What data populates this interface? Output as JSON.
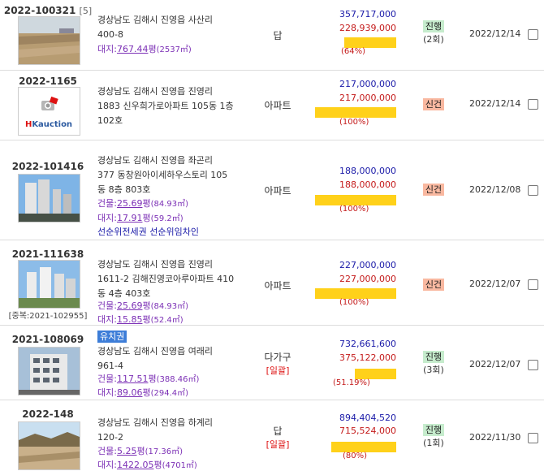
{
  "rows": [
    {
      "case": "2022-100321",
      "case_sub": "[5]",
      "addr": [
        "경상남도 김해시 진영읍 사산리",
        "400-8"
      ],
      "area_label": "대지:",
      "area_value": "767.44",
      "area_unit": "평",
      "area_m2": "(2537㎡)",
      "type": "답",
      "type_note": "",
      "price1": "357,717,000",
      "price2": "228,939,000",
      "percent": "(64%)",
      "ratio": 0.64,
      "status": "진행",
      "status_kind": "ing",
      "status_count": "(2회)",
      "date": "2022/12/14",
      "photo": "land"
    },
    {
      "case": "2022-1165",
      "addr": [
        "경상남도 김해시 진영읍 진영리",
        "1883 신우희가로아파트 105동 1층",
        "102호"
      ],
      "type": "아파트",
      "type_note": "",
      "price1": "217,000,000",
      "price2": "217,000,000",
      "percent": "(100%)",
      "ratio": 1.0,
      "status": "신건",
      "status_kind": "new",
      "status_count": "",
      "date": "2022/12/14",
      "photo": "logo",
      "logo_text": "Kauction",
      "logo_prefix": "H"
    },
    {
      "case": "2022-101416",
      "addr": [
        "경상남도 김해시 진영읍 좌곤리",
        "377 동창원아이세하우스토리 105",
        "동 8층 803호"
      ],
      "bld_label": "건물:",
      "bld_value": "25.69",
      "bld_unit": "평",
      "bld_m2": "(84.93㎡)",
      "land_label": "대지:",
      "land_value": "17.91",
      "land_unit": "평",
      "land_m2": "(59.2㎡)",
      "extra": "선순위전세권 선순위임차인",
      "type": "아파트",
      "type_note": "",
      "price1": "188,000,000",
      "price2": "188,000,000",
      "percent": "(100%)",
      "ratio": 1.0,
      "status": "신건",
      "status_kind": "new",
      "status_count": "",
      "date": "2022/12/08",
      "photo": "apt"
    },
    {
      "case": "2021-111638",
      "dup": "[중복:2021-102955]",
      "addr": [
        "경상남도 김해시 진영읍 진영리",
        "1611-2 김해진영코아루아파트 410",
        "동 4층 403호"
      ],
      "bld_label": "건물:",
      "bld_value": "25.69",
      "bld_unit": "평",
      "bld_m2": "(84.93㎡)",
      "land_label": "대지:",
      "land_value": "15.85",
      "land_unit": "평",
      "land_m2": "(52.4㎡)",
      "type": "아파트",
      "type_note": "",
      "price1": "227,000,000",
      "price2": "227,000,000",
      "percent": "(100%)",
      "ratio": 1.0,
      "status": "신건",
      "status_kind": "new",
      "status_count": "",
      "date": "2022/12/07",
      "photo": "apt2"
    },
    {
      "case": "2021-108069",
      "tag": "유치권",
      "addr": [
        "경상남도 김해시 진영읍 여래리",
        "961-4"
      ],
      "bld_label": "건물:",
      "bld_value": "117.51",
      "bld_unit": "평",
      "bld_m2": "(388.46㎡)",
      "land_label": "대지:",
      "land_value": "89.06",
      "land_unit": "평",
      "land_m2": "(294.4㎡)",
      "type": "다가구",
      "type_note": "[일괄]",
      "price1": "732,661,600",
      "price2": "375,122,000",
      "percent": "(51.19%)",
      "ratio": 0.5119,
      "status": "진행",
      "status_kind": "ing",
      "status_count": "(3회)",
      "date": "2022/12/07",
      "photo": "bldg"
    },
    {
      "case": "2022-148",
      "addr": [
        "경상남도 김해시 진영읍 하계리",
        "120-2"
      ],
      "bld_label": "건물:",
      "bld_value": "5.25",
      "bld_unit": "평",
      "bld_m2": "(17.36㎡)",
      "land_label": "대지:",
      "land_value": "1422.05",
      "land_unit": "평",
      "land_m2": "(4701㎡)",
      "type": "답",
      "type_note": "[일괄]",
      "price1": "894,404,520",
      "price2": "715,524,000",
      "percent": "(80%)",
      "ratio": 0.8,
      "status": "진행",
      "status_kind": "ing",
      "status_count": "(1회)",
      "date": "2022/11/30",
      "photo": "field"
    }
  ]
}
